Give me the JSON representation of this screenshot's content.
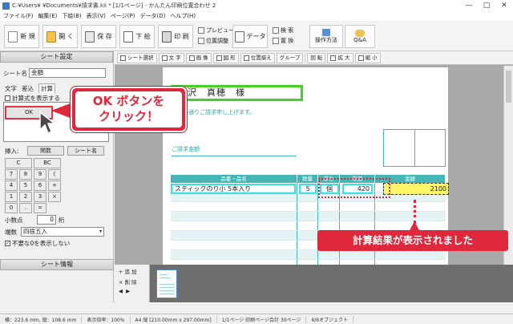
{
  "window": {
    "title": "C:¥Users¥  ¥Documents¥請求書.kii * [1/1ページ] - かんたん印刷位置合わせ 2",
    "controls": [
      "—",
      "□",
      "✕"
    ]
  },
  "menu": [
    "ファイル(F)",
    "編集(E)",
    "下絵(B)",
    "表示(V)",
    "ページ(P)",
    "データ(D)",
    "ヘルプ(H)"
  ],
  "toolbar": {
    "new": "新 規",
    "open": "開 く",
    "save": "保 存",
    "background": "下 絵",
    "print": "印 刷",
    "preview": "プレビュー",
    "position_adjust": "位置調整",
    "data": "データ",
    "search": "検 索",
    "replace": "置 換",
    "howto": "操作方法",
    "qa": "Q&A"
  },
  "left_panel": {
    "header": "シート設定",
    "sheet_name_label": "シート名",
    "sheet_name_value": "金額",
    "tabs": [
      "文字",
      "差込",
      "計算"
    ],
    "checkbox_label": "計算式を表示する",
    "ok_label": "OK",
    "insert_label": "挿入:",
    "function_btn": "関数",
    "sheet_name_btn": "シート名",
    "calc_keys": [
      "C",
      "BC",
      "7",
      "8",
      "9",
      "(",
      ")",
      "4",
      "5",
      "6",
      "+",
      "-",
      "1",
      "2",
      "3",
      "×",
      "+",
      "0",
      ".",
      "="
    ],
    "decimal_label": "小数点",
    "decimal_value": "0",
    "decimal_unit": "桁",
    "rounding_label": "端数",
    "rounding_value": "四捨五入",
    "hide_zero_label": "不要な0を表示しない",
    "info_header": "シート情報"
  },
  "canvas_toolbar": [
    "シート選択",
    "文 字",
    "画 像",
    "図 形",
    "位置揃え",
    "グループ",
    "回 転",
    "拡 大",
    "縮 小"
  ],
  "document": {
    "name": "北沢　真穂　様",
    "intro": "下記の通りご請求申し上げます。",
    "amount_label": "ご請求金額",
    "headers": [
      "品番・品名",
      "数量",
      "単位",
      "単価",
      "金額"
    ],
    "row": {
      "product": "スティックのり小 5本入り",
      "qty": "5",
      "unit": "個",
      "price": "420",
      "amount": "2100"
    }
  },
  "thumb_strip": {
    "add": "追 加",
    "delete": "削 除",
    "prev": "◀",
    "next": "▶"
  },
  "statusbar": [
    "横：223.6 mm, 縦：108.6 mm",
    "表示倍率：100%",
    "A4 縦 [210.00mm x 297.00mm]",
    "1/1ページ 印刷ページ合計 30ページ",
    "6/6オブジェクト"
  ],
  "callout_ok": {
    "line1": "OK ボタンを",
    "line2": "クリック！"
  },
  "callout_result": "計算結果が表示されました",
  "colors": {
    "accent_red": "#e0283c",
    "teal": "#46b5b5",
    "green": "#44d024",
    "highlight_yellow": "#fff566"
  }
}
